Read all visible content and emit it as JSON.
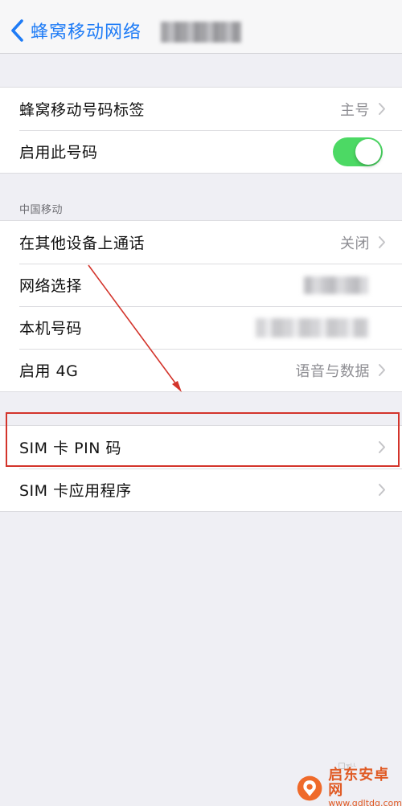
{
  "nav": {
    "back_label": "蜂窝移动网络",
    "title": ""
  },
  "group1": {
    "rows": [
      {
        "label": "蜂窝移动号码标签",
        "value": "主号"
      },
      {
        "label": "启用此号码",
        "toggle_on": true
      }
    ]
  },
  "section_header": "中国移动",
  "group2": {
    "rows": [
      {
        "label": "在其他设备上通话",
        "value": "关闭"
      },
      {
        "label": "网络选择",
        "value": ""
      },
      {
        "label": "本机号码",
        "value": ""
      },
      {
        "label": "启用 4G",
        "value": "语音与数据"
      }
    ]
  },
  "group3": {
    "rows": [
      {
        "label": "SIM 卡 PIN 码"
      },
      {
        "label": "SIM 卡应用程序"
      }
    ]
  },
  "watermark": {
    "name": "启东安卓网",
    "url": "www.qdltdq.com",
    "small": "口ᴛᴸᴸ"
  },
  "colors": {
    "accent": "#1f7cf6",
    "toggle_on": "#4cd964",
    "highlight": "#d3342b",
    "background": "#efeff4"
  }
}
